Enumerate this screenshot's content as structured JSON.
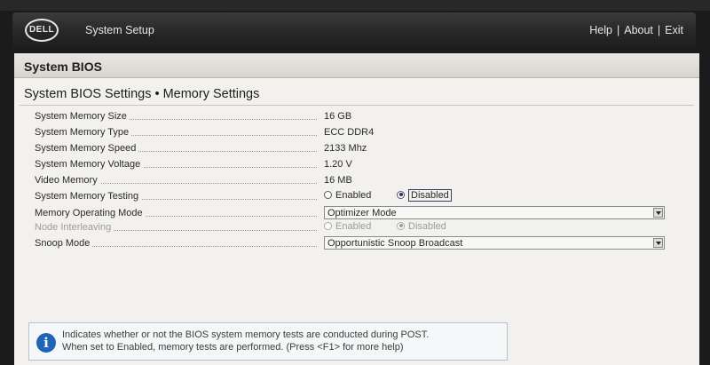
{
  "topbar": {
    "logo_text": "DELL",
    "app_title": "System Setup",
    "links": [
      "Help",
      "About",
      "Exit"
    ],
    "separator": "|"
  },
  "section_title": "System BIOS",
  "page_title": "System BIOS Settings • Memory Settings",
  "settings": [
    {
      "label": "System Memory Size",
      "value": "16 GB"
    },
    {
      "label": "System Memory Type",
      "value": "ECC DDR4"
    },
    {
      "label": "System Memory Speed",
      "value": "2133 Mhz"
    },
    {
      "label": "System Memory Voltage",
      "value": "1.20 V"
    },
    {
      "label": "Video Memory",
      "value": "16 MB"
    },
    {
      "label": "System Memory Testing",
      "options": [
        "Enabled",
        "Disabled"
      ],
      "selected": "Disabled"
    },
    {
      "label": "Memory Operating Mode",
      "value": "Optimizer Mode"
    },
    {
      "label": "Node Interleaving",
      "options": [
        "Enabled",
        "Disabled"
      ],
      "selected": "Disabled",
      "disabled": true
    },
    {
      "label": "Snoop Mode",
      "value": "Opportunistic Snoop Broadcast"
    }
  ],
  "help": {
    "line1": "Indicates whether or not the BIOS system memory tests are conducted during POST.",
    "line2": "When set to Enabled, memory tests are performed. (Press <F1> for more help)"
  },
  "colors": {
    "titlebar": "#262626",
    "panel": "#f2f1ed",
    "info_icon": "#1f64b7",
    "radio_selected": "#2c2c8c"
  }
}
